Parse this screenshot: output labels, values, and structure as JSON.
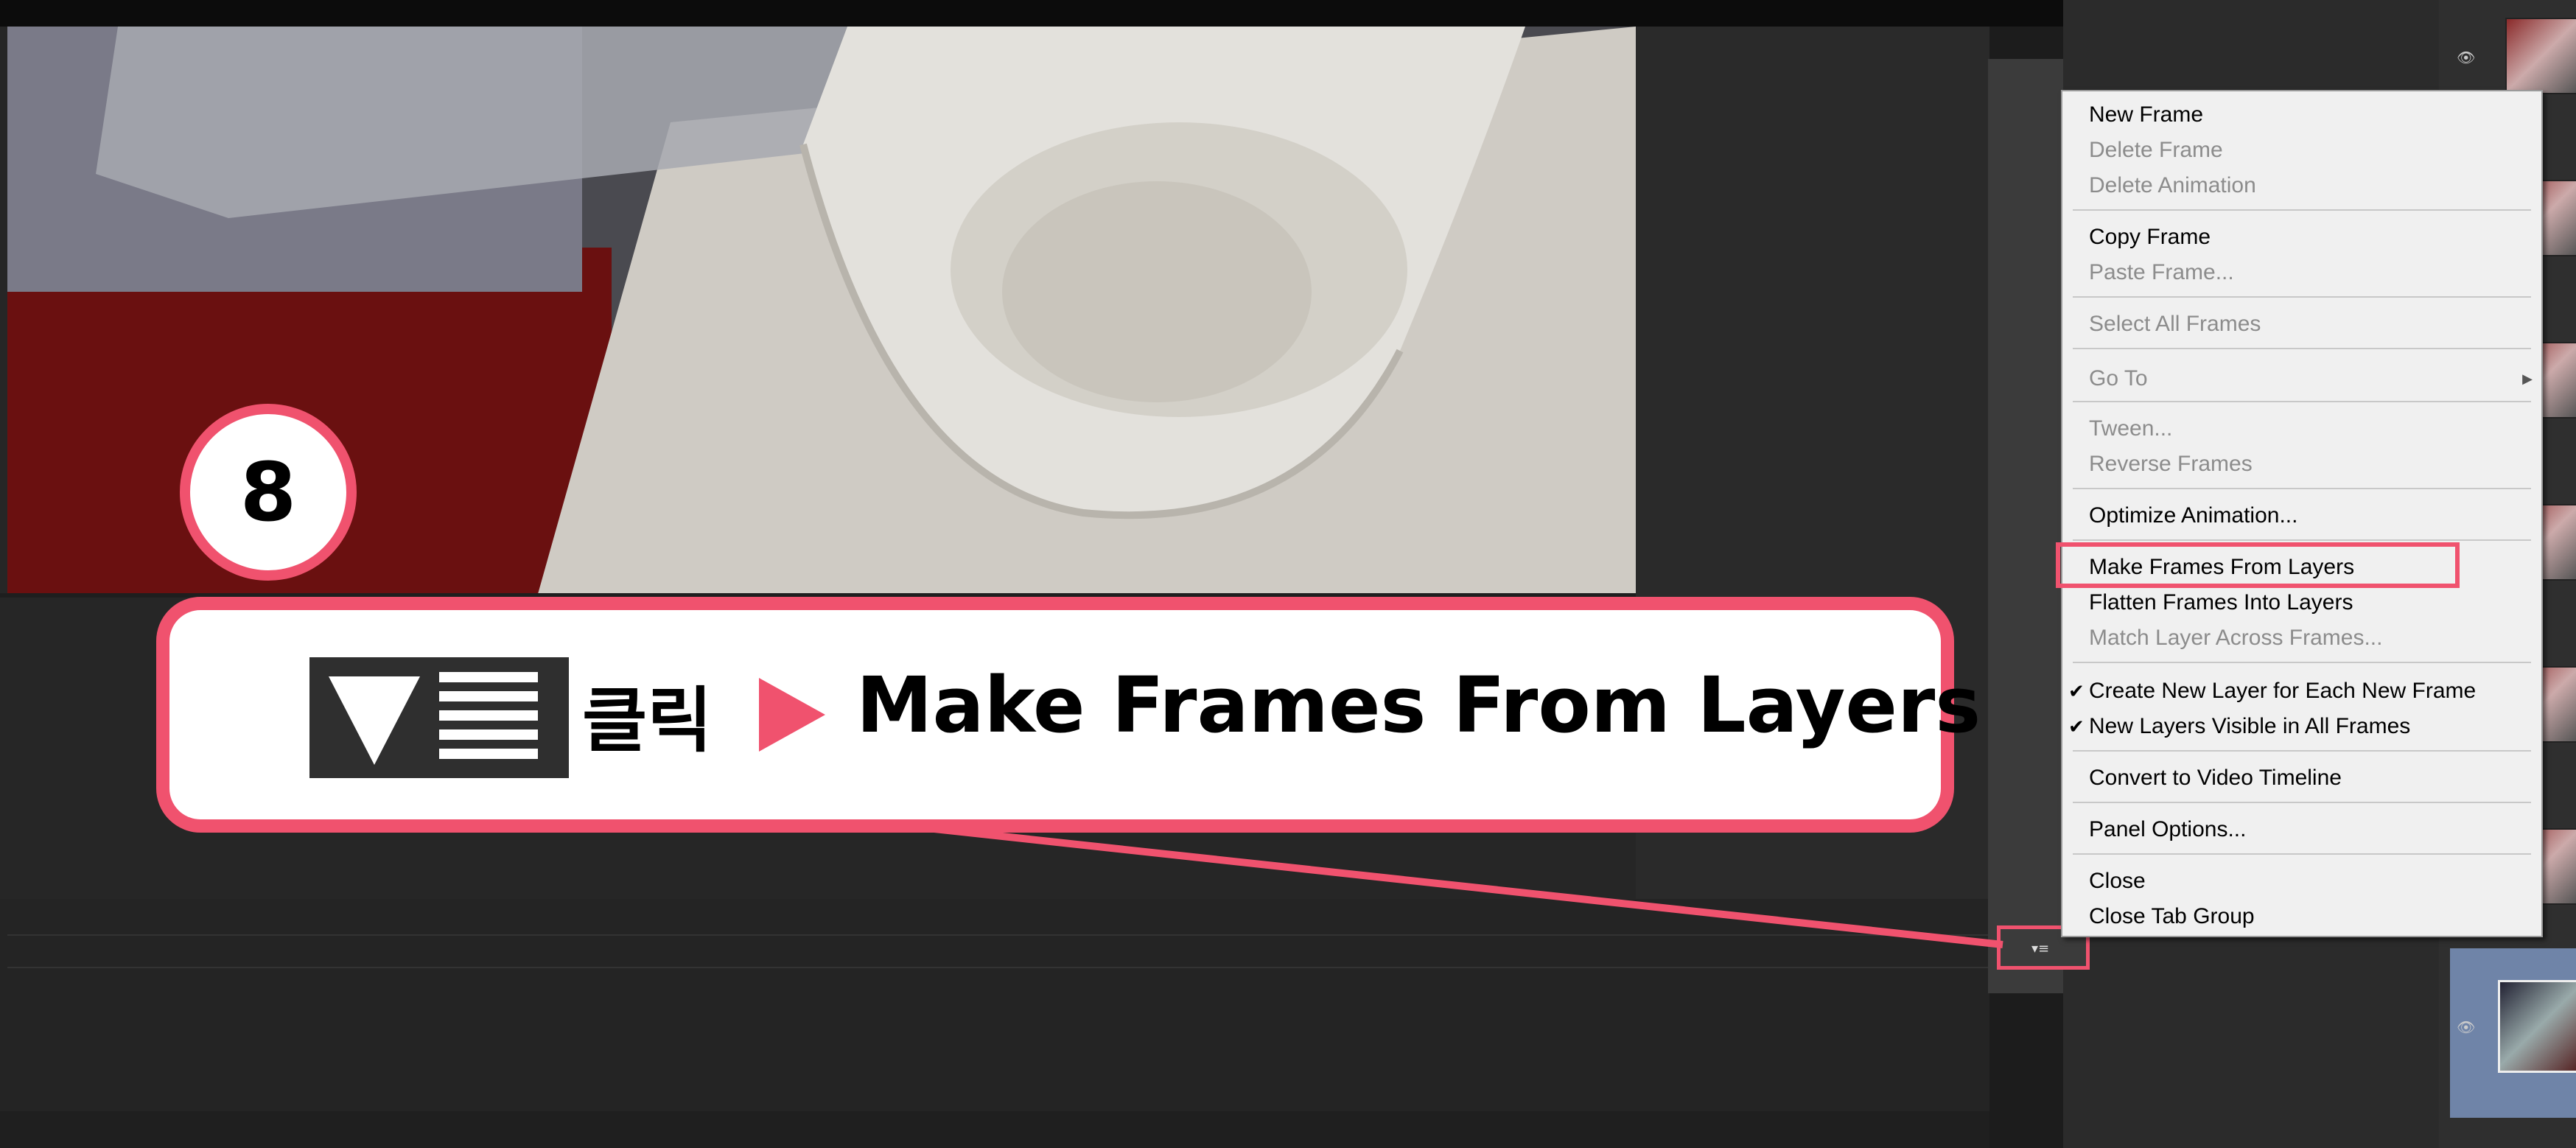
{
  "step": {
    "number": "8"
  },
  "callout": {
    "click_label": "클릭",
    "action_text": "Make Frames From Layers"
  },
  "panel_menu_button": {
    "glyph": "▾≡"
  },
  "context_menu": {
    "items": [
      {
        "label": "New Frame",
        "enabled": true
      },
      {
        "label": "Delete Frame",
        "enabled": false
      },
      {
        "label": "Delete Animation",
        "enabled": false
      },
      {
        "label": "Copy Frame",
        "enabled": true
      },
      {
        "label": "Paste Frame...",
        "enabled": false
      },
      {
        "label": "Select All Frames",
        "enabled": false
      },
      {
        "label": "Go To",
        "enabled": false,
        "submenu": true
      },
      {
        "label": "Tween...",
        "enabled": false
      },
      {
        "label": "Reverse Frames",
        "enabled": false
      },
      {
        "label": "Optimize Animation...",
        "enabled": true
      },
      {
        "label": "Make Frames From Layers",
        "enabled": true,
        "highlighted": true
      },
      {
        "label": "Flatten Frames Into Layers",
        "enabled": true
      },
      {
        "label": "Match Layer Across Frames...",
        "enabled": false
      },
      {
        "label": "Create New Layer for Each New Frame",
        "enabled": true,
        "checked": true
      },
      {
        "label": "New Layers Visible in All Frames",
        "enabled": true,
        "checked": true
      },
      {
        "label": "Convert to Video Timeline",
        "enabled": true
      },
      {
        "label": "Panel Options...",
        "enabled": true
      },
      {
        "label": "Close",
        "enabled": true
      },
      {
        "label": "Close Tab Group",
        "enabled": true
      }
    ],
    "check_glyph": "✔",
    "submenu_glyph": "▶"
  },
  "colors": {
    "accent": "#f0526e",
    "menu_bg": "#f0f0f0",
    "disabled_text": "#8c8c8c",
    "selected_layer": "#6f84a8"
  },
  "icons": {
    "eye": "eye-icon",
    "panel_menu": "panel-menu-icon",
    "triangle_down": "triangle-down-icon",
    "play_arrow": "play-arrow-icon"
  }
}
